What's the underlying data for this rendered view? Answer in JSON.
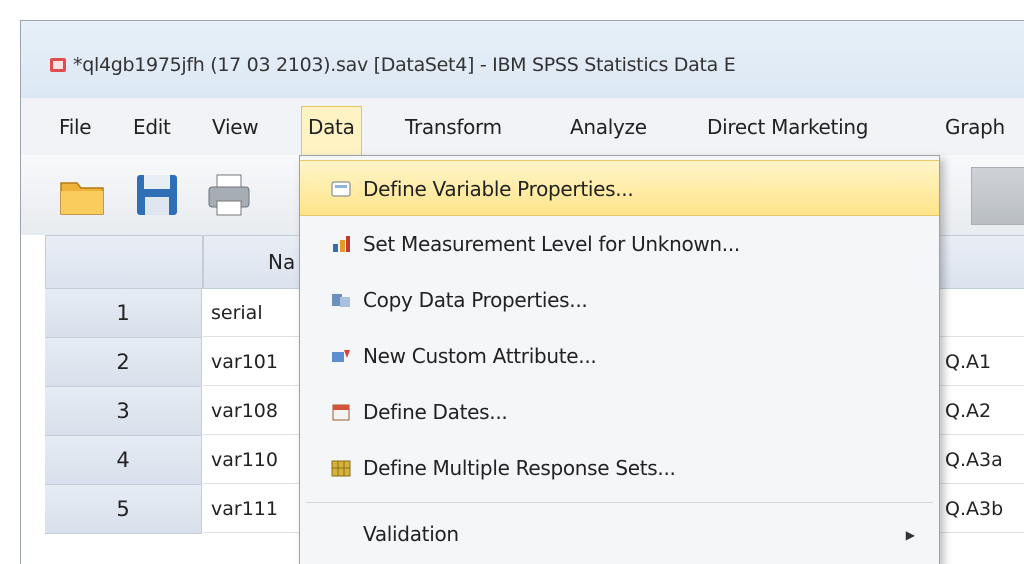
{
  "window": {
    "title": "*ql4gb1975jfh (17 03 2103).sav [DataSet4] - IBM SPSS Statistics Data E"
  },
  "menubar": {
    "items": [
      {
        "label": "File"
      },
      {
        "label": "Edit"
      },
      {
        "label": "View"
      },
      {
        "label": "Data",
        "active": true
      },
      {
        "label": "Transform"
      },
      {
        "label": "Analyze"
      },
      {
        "label": "Direct Marketing"
      },
      {
        "label": "Graph"
      }
    ]
  },
  "toolbar": {
    "buttons": [
      "open-folder-icon",
      "save-icon",
      "print-icon"
    ]
  },
  "grid": {
    "header_name": "Na",
    "rows": [
      {
        "num": "1",
        "name": "serial",
        "label": ""
      },
      {
        "num": "2",
        "name": "var101",
        "label": "Q.A1"
      },
      {
        "num": "3",
        "name": "var108",
        "label": "Q.A2"
      },
      {
        "num": "4",
        "name": "var110",
        "label": "Q.A3a"
      },
      {
        "num": "5",
        "name": "var111",
        "label": "Q.A3b"
      }
    ]
  },
  "data_menu": {
    "items": [
      {
        "label": "Define Variable Properties...",
        "icon": "define-variable-properties-icon"
      },
      {
        "label": "Set Measurement Level for Unknown...",
        "icon": "measurement-level-icon"
      },
      {
        "label": "Copy Data Properties...",
        "icon": "copy-data-properties-icon"
      },
      {
        "label": "New Custom Attribute...",
        "icon": "custom-attribute-icon"
      },
      {
        "label": "Define Dates...",
        "icon": "calendar-icon"
      },
      {
        "label": "Define Multiple Response Sets...",
        "icon": "multiple-response-icon"
      },
      {
        "label": "Validation",
        "icon": ""
      }
    ]
  },
  "colors": {
    "highlight": "#ffe48a",
    "menu_bg": "#f5f6f8"
  }
}
